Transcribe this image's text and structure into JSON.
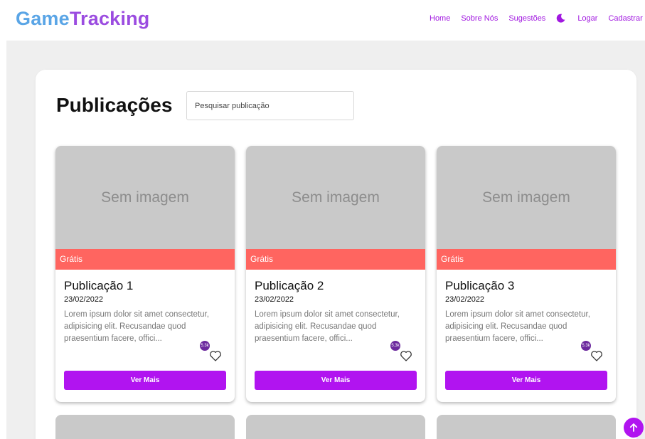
{
  "brand": {
    "part1": "Game",
    "part2": "Tracking"
  },
  "nav": {
    "home": "Home",
    "about": "Sobre Nós",
    "suggestions": "Sugestões",
    "theme_icon": "moon-icon",
    "login": "Logar",
    "register": "Cadastrar"
  },
  "page": {
    "title": "Publicações",
    "search_placeholder": "Pesquisar publicação"
  },
  "cards": [
    {
      "image_text": "Sem imagem",
      "tag": "Grátis",
      "title": "Publicação 1",
      "date": "23/02/2022",
      "description": "Lorem ipsum dolor sit amet consectetur, adipisicing elit. Recusandae quod praesentium facere, offici...",
      "likes": "5.3k",
      "button": "Ver Mais"
    },
    {
      "image_text": "Sem imagem",
      "tag": "Grátis",
      "title": "Publicação 2",
      "date": "23/02/2022",
      "description": "Lorem ipsum dolor sit amet consectetur, adipisicing elit. Recusandae quod praesentium facere, offici...",
      "likes": "5.3k",
      "button": "Ver Mais"
    },
    {
      "image_text": "Sem imagem",
      "tag": "Grátis",
      "title": "Publicação 3",
      "date": "23/02/2022",
      "description": "Lorem ipsum dolor sit amet consectetur, adipisicing elit. Recusandae quod praesentium facere, offici...",
      "likes": "5.3k",
      "button": "Ver Mais"
    }
  ],
  "icons": {
    "like": "heart-icon",
    "scroll_top": "arrow-up-icon"
  },
  "colors": {
    "accent": "#b114f0",
    "tag": "#ff6560",
    "brand_blue": "#5aa5e6",
    "brand_purple": "#9b4ce0",
    "badge": "#6c2a9e"
  }
}
